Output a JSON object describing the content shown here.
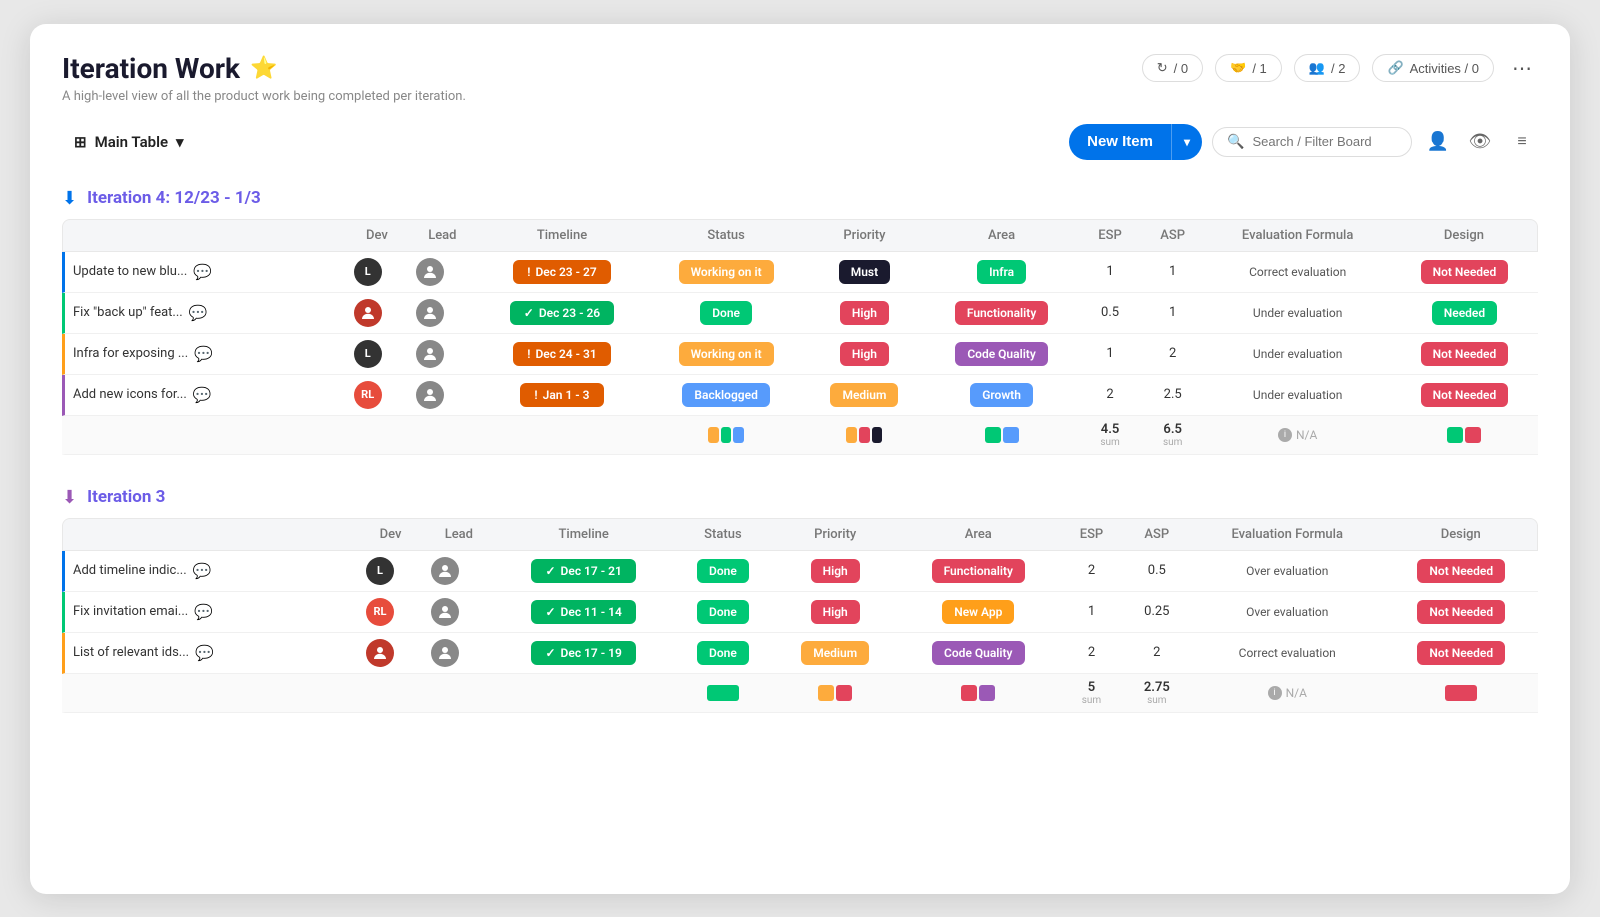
{
  "page": {
    "title": "Iteration Work",
    "star": "⭐",
    "subtitle": "A high-level view of all the product work being completed per iteration.",
    "actions": [
      {
        "label": "/ 0",
        "icon": "🔄"
      },
      {
        "label": "/ 1",
        "icon": "👥"
      },
      {
        "label": "/ 2",
        "icon": "👤"
      },
      {
        "label": "Activities / 0",
        "icon": "🔔"
      },
      {
        "label": "...",
        "icon": ""
      }
    ]
  },
  "toolbar": {
    "table_icon": "⊞",
    "table_label": "Main Table",
    "dropdown_icon": "▾",
    "new_item_label": "New Item",
    "new_item_arrow": "▾",
    "search_placeholder": "Search / Filter Board",
    "user_icon": "👤",
    "eye_icon": "👁",
    "filter_icon": "≡"
  },
  "iteration4": {
    "title": "Iteration 4: 12/23 - 1/3",
    "collapse_icon": "🔵",
    "columns": [
      "Dev",
      "Lead",
      "Timeline",
      "Status",
      "Priority",
      "Area",
      "ESP",
      "ASP",
      "Evaluation Formula",
      "Design"
    ],
    "rows": [
      {
        "name": "Update to new blu...",
        "border": "blue",
        "dev_avatar": "L",
        "dev_color": "dark",
        "lead_avatar": "person",
        "timeline": "Dec 23 - 27",
        "timeline_type": "orange",
        "timeline_icon": "!",
        "status": "Working on it",
        "status_type": "working",
        "priority": "Must",
        "priority_type": "must",
        "area": "Infra",
        "area_type": "infra",
        "esp": "1",
        "asp": "1",
        "evaluation": "Correct evaluation",
        "design": "Not Needed",
        "design_type": "not-needed"
      },
      {
        "name": "Fix \"back up\" feat...",
        "border": "green",
        "dev_avatar": "person2",
        "dev_color": "red",
        "lead_avatar": "person",
        "timeline": "Dec 23 - 26",
        "timeline_type": "green",
        "timeline_icon": "✓",
        "status": "Done",
        "status_type": "done",
        "priority": "High",
        "priority_type": "high",
        "area": "Functionality",
        "area_type": "functionality",
        "esp": "0.5",
        "asp": "1",
        "evaluation": "Under evaluation",
        "design": "Needed",
        "design_type": "needed"
      },
      {
        "name": "Infra for exposing ...",
        "border": "orange",
        "dev_avatar": "L",
        "dev_color": "dark",
        "lead_avatar": "person",
        "timeline": "Dec 24 - 31",
        "timeline_type": "orange",
        "timeline_icon": "!",
        "status": "Working on it",
        "status_type": "working",
        "priority": "High",
        "priority_type": "high",
        "area": "Code Quality",
        "area_type": "code-quality",
        "esp": "1",
        "asp": "2",
        "evaluation": "Under evaluation",
        "design": "Not Needed",
        "design_type": "not-needed"
      },
      {
        "name": "Add new icons for...",
        "border": "purple",
        "dev_avatar": "RL",
        "dev_color": "red",
        "lead_avatar": "person",
        "timeline": "Jan 1 - 3",
        "timeline_type": "orange",
        "timeline_icon": "!",
        "status": "Backlogged",
        "status_type": "backlogged",
        "priority": "Medium",
        "priority_type": "medium",
        "area": "Growth",
        "area_type": "growth",
        "esp": "2",
        "asp": "2.5",
        "evaluation": "Under evaluation",
        "design": "Not Needed",
        "design_type": "not-needed"
      }
    ],
    "summary": {
      "esp_sum": "4.5",
      "asp_sum": "6.5",
      "na_label": "N/A",
      "status_colors": [
        "#fdab3d",
        "#00c875",
        "#579bfc"
      ],
      "priority_colors": [
        "#fdab3d",
        "#e2445c",
        "#1a1a2e"
      ],
      "area_colors": [
        "#00c875",
        "#579bfc"
      ],
      "design_colors": [
        "#00c875",
        "#e2445c"
      ]
    }
  },
  "iteration3": {
    "title": "Iteration 3",
    "collapse_icon": "🟣",
    "columns": [
      "Dev",
      "Lead",
      "Timeline",
      "Status",
      "Priority",
      "Area",
      "ESP",
      "ASP",
      "Evaluation Formula",
      "Design"
    ],
    "rows": [
      {
        "name": "Add timeline indic...",
        "border": "blue",
        "dev_avatar": "L",
        "dev_color": "dark",
        "lead_avatar": "person",
        "timeline": "Dec 17 - 21",
        "timeline_type": "green",
        "timeline_icon": "✓",
        "status": "Done",
        "status_type": "done",
        "priority": "High",
        "priority_type": "high",
        "area": "Functionality",
        "area_type": "functionality",
        "esp": "2",
        "asp": "0.5",
        "evaluation": "Over evaluation",
        "design": "Not Needed",
        "design_type": "not-needed"
      },
      {
        "name": "Fix invitation emai...",
        "border": "green",
        "dev_avatar": "RL",
        "dev_color": "red",
        "lead_avatar": "person",
        "timeline": "Dec 11 - 14",
        "timeline_type": "green",
        "timeline_icon": "✓",
        "status": "Done",
        "status_type": "done",
        "priority": "High",
        "priority_type": "high",
        "area": "New App",
        "area_type": "new-app",
        "esp": "1",
        "asp": "0.25",
        "evaluation": "Over evaluation",
        "design": "Not Needed",
        "design_type": "not-needed"
      },
      {
        "name": "List of relevant ids...",
        "border": "orange",
        "dev_avatar": "person2",
        "dev_color": "red",
        "lead_avatar": "person",
        "timeline": "Dec 17 - 19",
        "timeline_type": "green",
        "timeline_icon": "✓",
        "status": "Done",
        "status_type": "done",
        "priority": "Medium",
        "priority_type": "medium",
        "area": "Code Quality",
        "area_type": "code-quality",
        "esp": "2",
        "asp": "2",
        "evaluation": "Correct evaluation",
        "design": "Not Needed",
        "design_type": "not-needed"
      }
    ],
    "summary": {
      "esp_sum": "5",
      "asp_sum": "2.75",
      "na_label": "N/A",
      "status_colors": [
        "#00c875"
      ],
      "priority_colors": [
        "#fdab3d",
        "#e2445c"
      ],
      "area_colors": [
        "#e2445c",
        "#9b59b6"
      ],
      "design_colors": [
        "#e2445c"
      ]
    }
  }
}
